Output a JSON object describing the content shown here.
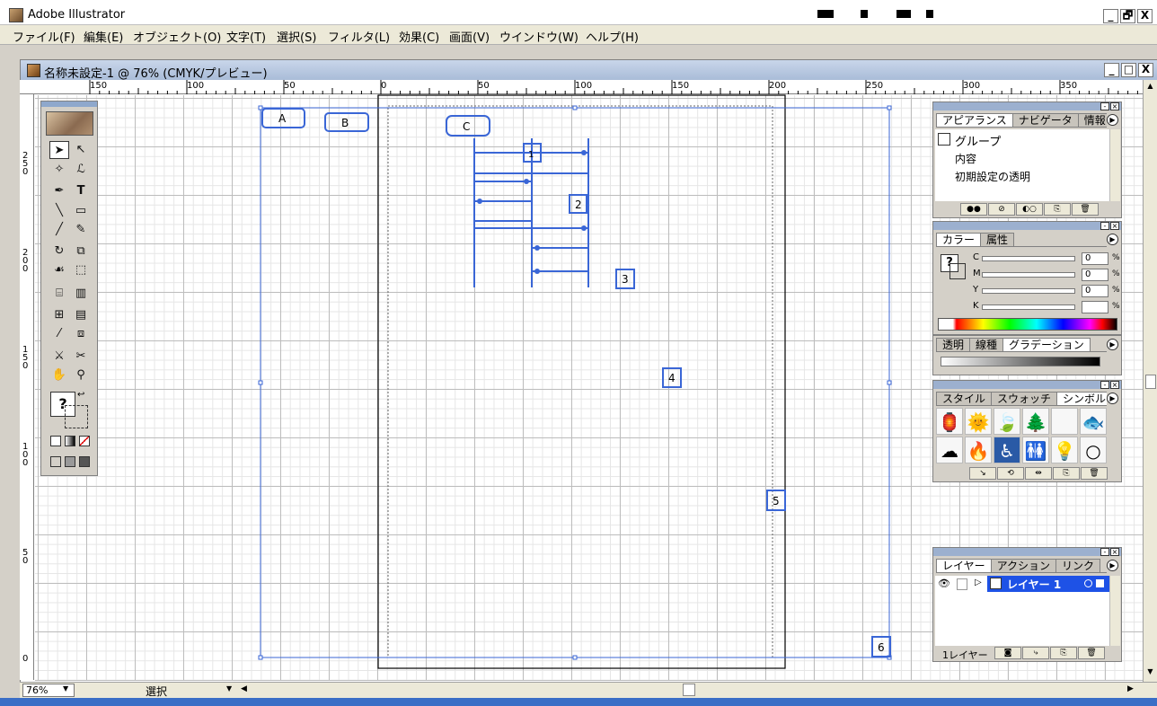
{
  "app": {
    "title": "Adobe Illustrator",
    "menu": [
      "ファイル(F)",
      "編集(E)",
      "オブジェクト(O)",
      "文字(T)",
      "選択(S)",
      "フィルタ(L)",
      "効果(C)",
      "画面(V)",
      "ウインドウ(W)",
      "ヘルプ(H)"
    ],
    "window_buttons": [
      "_",
      "🗗",
      "X"
    ]
  },
  "document": {
    "title": "名称未設定-1 @ 76% (CMYK/プレビュー)",
    "window_buttons": [
      "_",
      "□",
      "X"
    ],
    "ruler_h_labels": [
      "150",
      "100",
      "50",
      "0",
      "50",
      "100",
      "150",
      "200",
      "250",
      "300",
      "350"
    ],
    "ruler_v_labels": [
      "250",
      "200",
      "150",
      "100",
      "50",
      "0"
    ]
  },
  "canvas_labels": {
    "a": "A",
    "b": "B",
    "c": "C",
    "n1": "1",
    "n2": "2",
    "n3": "3",
    "n4": "4",
    "n5": "5",
    "n6": "6"
  },
  "status": {
    "zoom": "76%",
    "mode": "選択"
  },
  "toolbox": {
    "icons": [
      "selection-tool",
      "direct-selection-tool",
      "magic-wand-tool",
      "lasso-tool",
      "pen-tool",
      "type-tool",
      "line-tool",
      "rectangle-tool",
      "paintbrush-tool",
      "pencil-tool",
      "rotate-tool",
      "scale-tool",
      "warp-tool",
      "free-transform-tool",
      "symbol-sprayer-tool",
      "graph-tool",
      "mesh-tool",
      "gradient-tool",
      "eyedropper-tool",
      "blend-tool",
      "slice-tool",
      "scissors-tool",
      "hand-tool",
      "zoom-tool"
    ],
    "fill_label": "?"
  },
  "appearance_panel": {
    "tabs": [
      "アピアランス",
      "ナビゲータ",
      "情報"
    ],
    "group_label": "グループ",
    "items": [
      "内容",
      "初期設定の透明"
    ]
  },
  "color_panel": {
    "tabs": [
      "カラー",
      "属性"
    ],
    "channels": [
      {
        "label": "C",
        "value": "0",
        "unit": "%"
      },
      {
        "label": "M",
        "value": "0",
        "unit": "%"
      },
      {
        "label": "Y",
        "value": "0",
        "unit": "%"
      },
      {
        "label": "K",
        "value": "",
        "unit": "%"
      }
    ]
  },
  "gradient_panel": {
    "tabs": [
      "透明",
      "線種",
      "グラデーション"
    ]
  },
  "swatch_panel": {
    "tabs": [
      "スタイル",
      "スウォッチ",
      "シンボル"
    ],
    "symbols": [
      "🏮",
      "🌞",
      "🍃",
      "🌲",
      "",
      "🐟",
      "☁",
      "🔥",
      "♿",
      "🚻",
      "💡",
      "○"
    ]
  },
  "layers_panel": {
    "tabs": [
      "レイヤー",
      "アクション",
      "リンク"
    ],
    "layer_name": "レイヤー 1",
    "footer": "1レイヤー"
  },
  "colors": {
    "selection": "#3a66d6",
    "titlebar": "#a9bcd8",
    "layer_highlight": "#1e52e6"
  }
}
